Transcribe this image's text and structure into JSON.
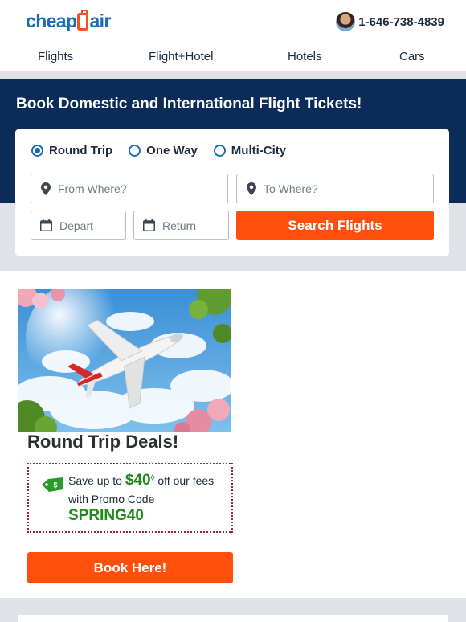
{
  "header": {
    "logo": {
      "left": "cheap",
      "right": "air"
    },
    "phone": "1-646-738-4839"
  },
  "nav": {
    "items": [
      {
        "label": "Flights"
      },
      {
        "label": "Flight+Hotel"
      },
      {
        "label": "Hotels"
      },
      {
        "label": "Cars"
      }
    ]
  },
  "hero": {
    "title": "Book Domestic and International Flight Tickets!"
  },
  "search": {
    "trip_types": [
      {
        "label": "Round Trip",
        "selected": true
      },
      {
        "label": "One Way",
        "selected": false
      },
      {
        "label": "Multi-City",
        "selected": false
      }
    ],
    "from_placeholder": "From Where?",
    "to_placeholder": "To Where?",
    "depart_placeholder": "Depart",
    "return_placeholder": "Return",
    "button_label": "Search Flights"
  },
  "deal": {
    "title": "Round Trip Deals!",
    "promo": {
      "prefix": "Save up to ",
      "amount": "$40",
      "mark": "◊",
      "suffix": " off our fees",
      "line2": "with Promo Code",
      "code": "SPRING40"
    },
    "button_label": "Book Here!"
  },
  "colors": {
    "brand_blue": "#1a6bb8",
    "brand_orange": "#f05323",
    "hero_navy": "#0b2c59",
    "cta_orange": "#ff4f0d",
    "promo_green": "#1e8a19",
    "promo_border": "#a02040"
  }
}
